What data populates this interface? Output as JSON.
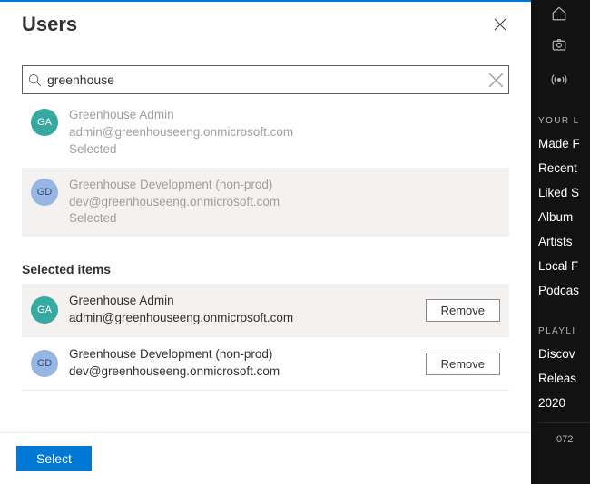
{
  "panel": {
    "title": "Users",
    "search": {
      "value": "greenhouse",
      "placeholder": "Search"
    },
    "suggestions": [
      {
        "initials": "GA",
        "avatarClass": "avatar-teal",
        "name": "Greenhouse Admin",
        "email": "admin@greenhouseeng.onmicrosoft.com",
        "state": "Selected"
      },
      {
        "initials": "GD",
        "avatarClass": "avatar-blue",
        "name": "Greenhouse Development (non-prod)",
        "email": "dev@greenhouseeng.onmicrosoft.com",
        "state": "Selected"
      }
    ],
    "selectedHeader": "Selected items",
    "selected": [
      {
        "initials": "GA",
        "avatarClass": "avatar-teal",
        "name": "Greenhouse Admin",
        "email": "admin@greenhouseeng.onmicrosoft.com"
      },
      {
        "initials": "GD",
        "avatarClass": "avatar-blue",
        "name": "Greenhouse Development (non-prod)",
        "email": "dev@greenhouseeng.onmicrosoft.com"
      }
    ],
    "removeLabel": "Remove",
    "selectLabel": "Select"
  },
  "sidebar": {
    "sectionA": "YOUR L",
    "itemsA": [
      "Made F",
      "Recent",
      "Liked S",
      "Album",
      "Artists",
      "Local F",
      "Podcas"
    ],
    "sectionB": "PLAYLI",
    "itemsB": [
      "Discov",
      "Releas",
      "2020"
    ],
    "numeric": "072"
  }
}
